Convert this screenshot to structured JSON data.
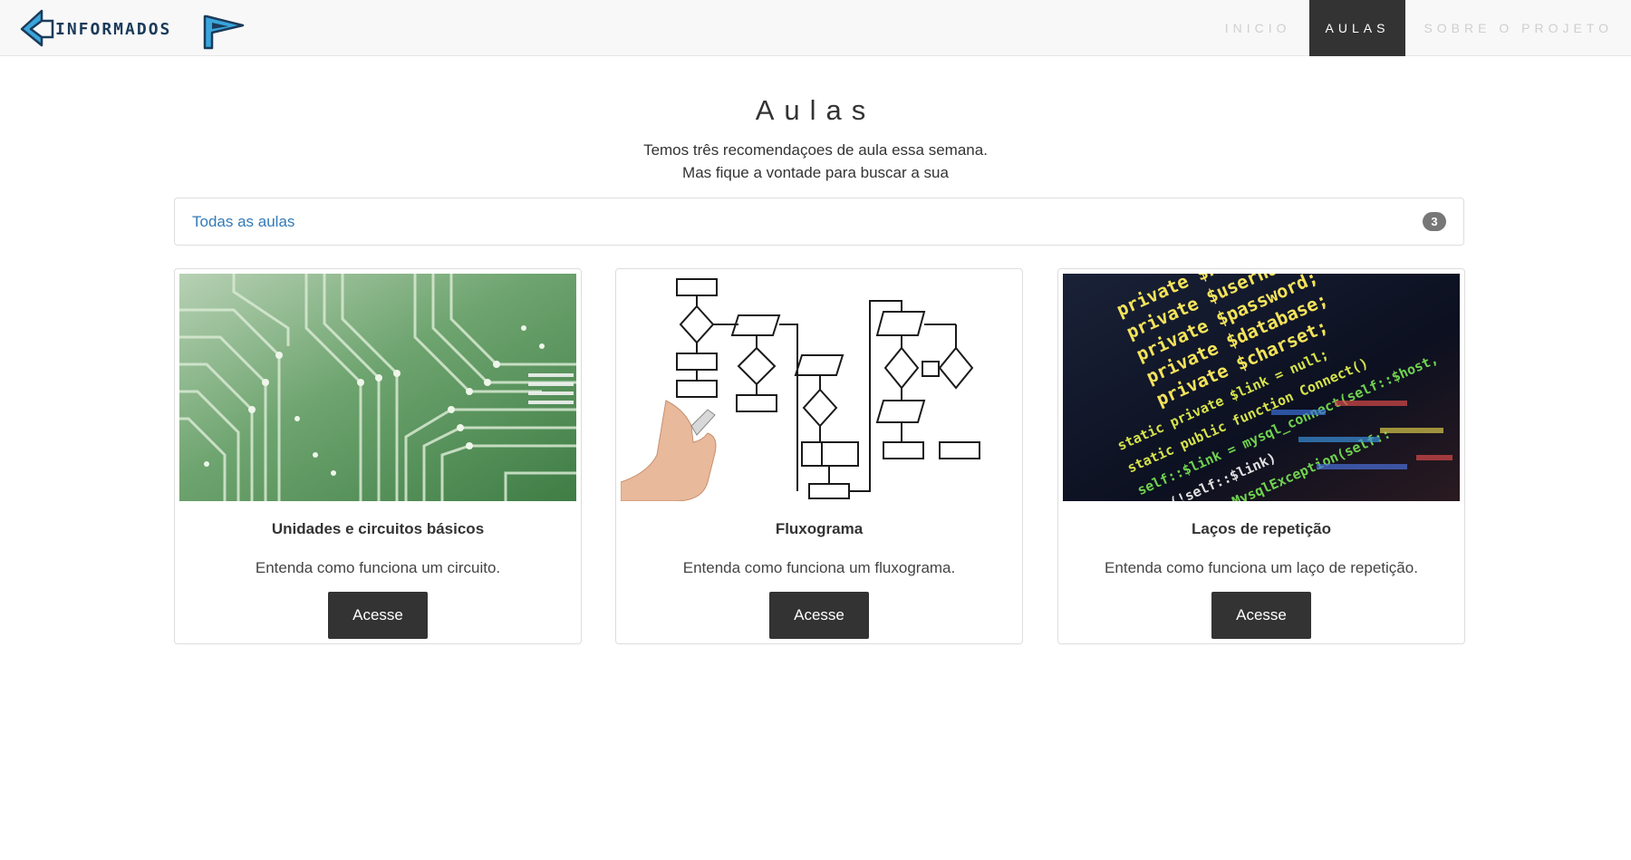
{
  "brand": {
    "logo_text": "INFORMADOS"
  },
  "nav": {
    "items": [
      {
        "label": "INICIO"
      },
      {
        "label": "AULAS"
      },
      {
        "label": "SOBRE O PROJETO"
      }
    ]
  },
  "header": {
    "title": "Aulas",
    "line1": "Temos três recomendaçoes de aula essa semana.",
    "line2": "Mas fique a vontade para buscar a sua"
  },
  "all_lessons": {
    "label": "Todas as aulas",
    "count": "3"
  },
  "cards": [
    {
      "title": "Unidades e circuitos básicos",
      "description": "Entenda como funciona um circuito.",
      "button": "Acesse",
      "image": "circuit-board-image"
    },
    {
      "title": "Fluxograma",
      "description": "Entenda como funciona um fluxograma.",
      "button": "Acesse",
      "image": "flowchart-image"
    },
    {
      "title": "Laços de repetição",
      "description": "Entenda como funciona um laço de repetição.",
      "button": "Acesse",
      "image": "code-screen-image"
    }
  ],
  "code_lines": [
    {
      "text": "private $host;",
      "color": "#f4e35a"
    },
    {
      "text": "private $username;",
      "color": "#f4e35a"
    },
    {
      "text": "private $password;",
      "color": "#f4e35a"
    },
    {
      "text": "private $database;",
      "color": "#f4e35a"
    },
    {
      "text": "private $charset;",
      "color": "#f4e35a"
    },
    {
      "text": "static private $link = null;",
      "color": "#d6e34a"
    },
    {
      "text": "static public function Connect()",
      "color": "#d6e34a"
    },
    {
      "text": "self::$link = mysql_connect(self::$host,",
      "color": "#6fd24e"
    },
    {
      "text": "if (!self::$link)",
      "color": "#e0e0e0"
    },
    {
      "text": "throw new MysqlException(self::",
      "color": "#6fd24e"
    }
  ],
  "colors": {
    "navbar_bg": "#f8f8f8",
    "active_nav_bg": "#333333",
    "link": "#337ab7",
    "badge": "#777777",
    "button": "#333333",
    "pcb_green": "#5a9a5e"
  }
}
